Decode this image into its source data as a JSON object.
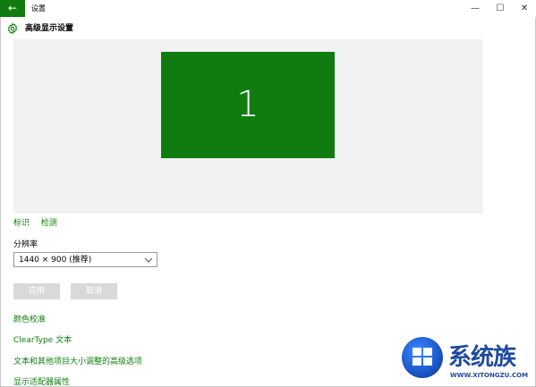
{
  "window": {
    "back_glyph": "←",
    "title": "设置",
    "min_glyph": "—",
    "max_glyph": "☐",
    "close_glyph": "✕"
  },
  "page": {
    "title": "高级显示设置",
    "gear_icon": "gear-icon"
  },
  "preview": {
    "monitor_number": "1",
    "identify_link": "标识",
    "detect_link": "检测"
  },
  "resolution": {
    "label": "分辨率",
    "selected": "1440 × 900 (推荐)"
  },
  "buttons": {
    "apply": "应用",
    "cancel": "取消"
  },
  "links": {
    "color_calibration": "颜色校准",
    "cleartype": "ClearType 文本",
    "advanced_sizing": "文本和其他项目大小调整的高级选项",
    "adapter_properties": "显示适配器属性"
  },
  "watermark": {
    "brand": "系统族",
    "url": "WWW.XITONGZU.COM"
  },
  "colors": {
    "accent": "#107c10",
    "preview_bg": "#f2f2f2",
    "disabled_button": "#d9d9d9"
  }
}
